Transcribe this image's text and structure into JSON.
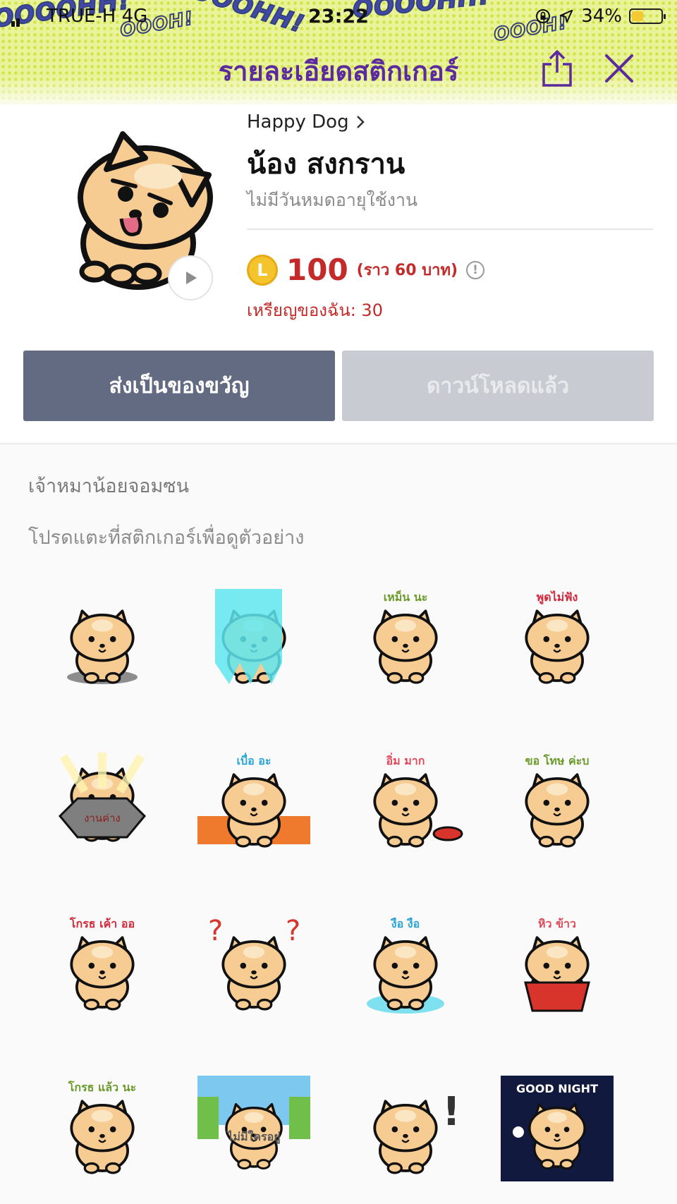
{
  "status_bar": {
    "carrier": "TRUE-H  4G",
    "time": "23:22",
    "battery": "34%"
  },
  "header": {
    "title": "รายละเอียดสติกเกอร์",
    "deco_texts": [
      "OOOOHH!",
      "OOOH!",
      "OOOOHH!",
      "OOOOHH!",
      "OOOH!"
    ],
    "share_icon": "share-icon",
    "close_icon": "close-icon"
  },
  "sticker": {
    "author": "Happy Dog",
    "name": "น้อง สงกราน",
    "expiry": "ไม่มีวันหมดอายุใช้งาน",
    "coin_letter": "L",
    "price": "100",
    "price_note": "(ราว  60 บาท)",
    "info_symbol": "!",
    "my_coins": "เหรียญของฉัน: 30"
  },
  "buttons": {
    "gift": "ส่งเป็นของขวัญ",
    "downloaded": "ดาวน์โหลดแล้ว"
  },
  "description": "เจ้าหมาน้อยจอมซน",
  "hint": "โปรดแตะที่สติกเกอร์เพื่อดูตัวอย่าง",
  "grid_stickers": [
    {
      "caption": "",
      "prop": "shadow"
    },
    {
      "caption": "",
      "prop": "water"
    },
    {
      "caption": "เหม็น นะ",
      "prop": "none"
    },
    {
      "caption": "พูดไม่ฟัง",
      "prop": "none"
    },
    {
      "caption": "",
      "prop": "rock",
      "prop_text": "งานค่าง"
    },
    {
      "caption": "เบื่อ อะ",
      "prop": "wall"
    },
    {
      "caption": "อิ่ม มาก",
      "prop": "bowl"
    },
    {
      "caption": "ขอ  โทษ  ค่ะบ",
      "prop": "none"
    },
    {
      "caption": "โกรธ เค้า ออ",
      "prop": "none"
    },
    {
      "caption": "",
      "prop": "question"
    },
    {
      "caption": "งือ          งือ",
      "prop": "tears"
    },
    {
      "caption": "หิว          ข้าว",
      "prop": "bowl-big"
    },
    {
      "caption": "โกรธ แล้ว นะ",
      "prop": "none"
    },
    {
      "caption": "ไม่มีใครอยู่",
      "prop": "scene"
    },
    {
      "caption": "!",
      "prop": "none"
    },
    {
      "caption": "GOOD NIGHT",
      "prop": "night"
    }
  ]
}
